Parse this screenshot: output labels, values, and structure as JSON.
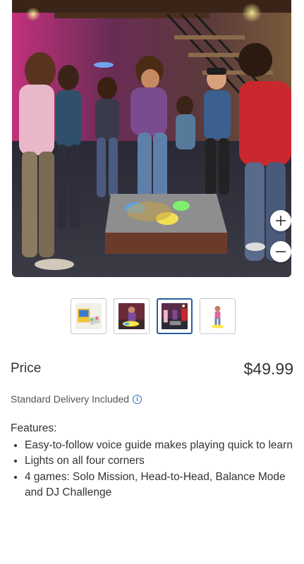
{
  "gallery": {
    "main_image_alt": "Kids playing on a light-up dance board",
    "zoom_in_icon": "plus-icon",
    "zoom_out_icon": "minus-icon",
    "thumbnails": [
      {
        "name": "thumbnail-1",
        "active": false
      },
      {
        "name": "thumbnail-2",
        "active": false
      },
      {
        "name": "thumbnail-3",
        "active": true
      },
      {
        "name": "thumbnail-4",
        "active": false
      }
    ],
    "active_border_color": "#2a5d9f"
  },
  "price": {
    "label": "Price",
    "value": "$49.99"
  },
  "delivery": {
    "text": "Standard Delivery Included",
    "info_icon": "info-icon",
    "info_glyph": "i"
  },
  "features": {
    "heading": "Features:",
    "items": [
      "Easy-to-follow voice guide makes playing quick to learn",
      "Lights on all four corners",
      "4 games: Solo Mission, Head-to-Head, Balance Mode and DJ Challenge"
    ]
  }
}
